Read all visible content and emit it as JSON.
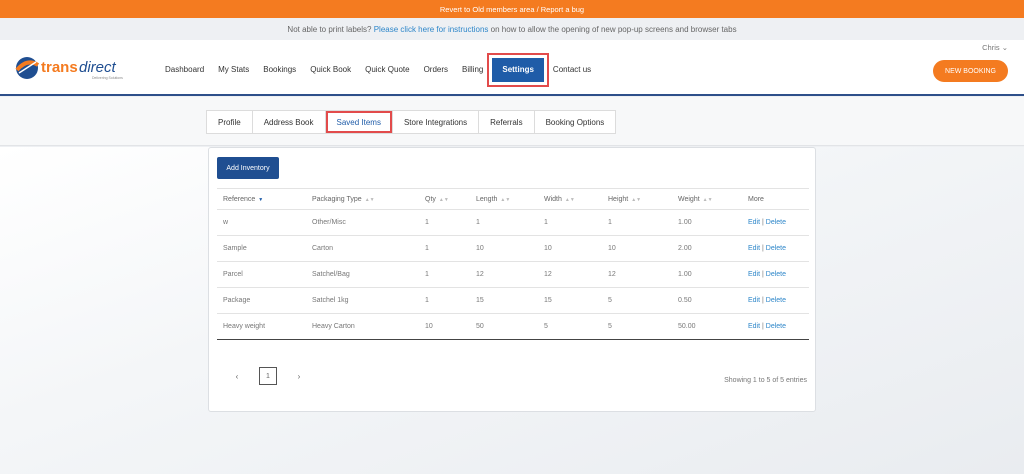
{
  "banner": {
    "text": "Revert to Old members area / Report a bug"
  },
  "notice": {
    "prefix": "Not able to print labels? ",
    "link": "Please click here for instructions",
    "suffix": " on how to allow the opening of new pop-up screens and browser tabs"
  },
  "user": {
    "name": "Chris ⌄"
  },
  "logo": {
    "brand_a": "trans",
    "brand_b": "direct",
    "tagline": "Delivering Solutions"
  },
  "nav": {
    "items": [
      "Dashboard",
      "My Stats",
      "Bookings",
      "Quick Book",
      "Quick Quote",
      "Orders",
      "Billing",
      "Settings",
      "Contact us"
    ],
    "active": "Settings"
  },
  "new_booking": "NEW BOOKING",
  "tabs": {
    "items": [
      "Profile",
      "Address Book",
      "Saved Items",
      "Store Integrations",
      "Referrals",
      "Booking Options"
    ],
    "active": "Saved Items"
  },
  "add_inventory": "Add Inventory",
  "table": {
    "headers": [
      "Reference",
      "Packaging Type",
      "Qty",
      "Length",
      "Width",
      "Height",
      "Weight",
      "More"
    ],
    "rows": [
      [
        "w",
        "Other/Misc",
        "1",
        "1",
        "1",
        "1",
        "1.00"
      ],
      [
        "Sample",
        "Carton",
        "1",
        "10",
        "10",
        "10",
        "2.00"
      ],
      [
        "Parcel",
        "Satchel/Bag",
        "1",
        "12",
        "12",
        "12",
        "1.00"
      ],
      [
        "Package",
        "Satchel 1kg",
        "1",
        "15",
        "15",
        "5",
        "0.50"
      ],
      [
        "Heavy weight",
        "Heavy Carton",
        "10",
        "50",
        "5",
        "5",
        "50.00"
      ]
    ],
    "edit_label": "Edit",
    "sep": " | ",
    "delete_label": "Delete"
  },
  "pager": {
    "prev": "‹",
    "page": "1",
    "next": "›"
  },
  "showing": "Showing 1 to 5 of 5 entries",
  "colors": {
    "orange": "#f47b20",
    "navy": "#1f5ca8",
    "highlight": "#e24b4b",
    "link": "#2d86c9"
  }
}
